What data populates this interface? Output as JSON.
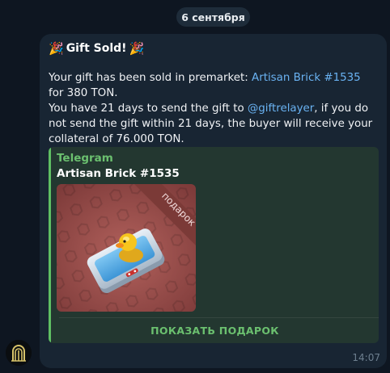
{
  "date_separator": "6 сентября",
  "message": {
    "title_emoji": "🎉",
    "title": "Gift Sold!",
    "line1_prefix": "Your gift has been sold in premarket: ",
    "gift_link": "Artisan Brick #1535",
    "line1_suffix": " for 380 TON.",
    "line2_prefix": "You have 21 days to send the gift to ",
    "mention": "@giftrelayer",
    "line2_suffix": ", if you do not send the gift within 21 days, the buyer will receive your collateral of 76.000 TON.",
    "time": "14:07"
  },
  "preview": {
    "site_name": "Telegram",
    "title": "Artisan Brick #1535",
    "ribbon": "подарок",
    "button_label": "ПОКАЗАТЬ ПОДАРОК"
  },
  "colors": {
    "background": "#0e1621",
    "bubble": "#182533",
    "link": "#6ab3f3",
    "accent_green": "#5fbf63",
    "gift_background": "#a0524f"
  },
  "icons": {
    "party": "party-popper-icon",
    "avatar": "bot-avatar-logo-icon",
    "gift": "gift-brick-icon"
  }
}
